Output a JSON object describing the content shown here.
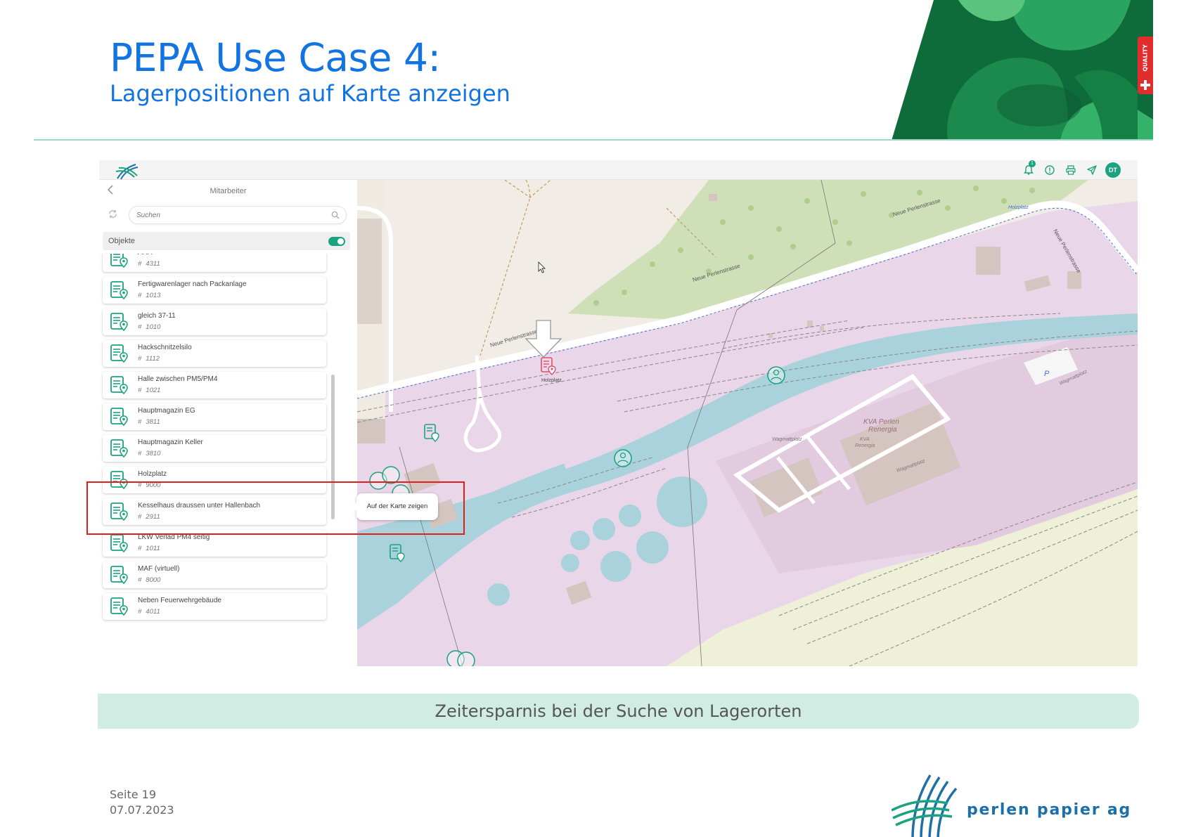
{
  "slide": {
    "title": "PEPA Use Case 4:",
    "subtitle": "Lagerpositionen auf Karte anzeigen",
    "banner": "Zeitersparnis bei der Suche von Lagerorten",
    "page_label": "Seite 19",
    "date": "07.07.2023",
    "company": "perlen papier ag",
    "quality_badge": "QUALITY"
  },
  "app": {
    "topbar": {
      "icons": [
        "bell-icon",
        "alert-icon",
        "printer-icon",
        "send-icon"
      ],
      "notification_count": "1",
      "avatar_initials": "DT"
    },
    "sidebar": {
      "title": "Mitarbeiter",
      "search_placeholder": "Suchen",
      "filter_label": "Objekte",
      "filter_enabled": true,
      "items": [
        {
          "name": "ARA",
          "number": "4311"
        },
        {
          "name": "Fertigwarenlager nach Packanlage",
          "number": "1013"
        },
        {
          "name": "gleich 37-11",
          "number": "1010"
        },
        {
          "name": "Hackschnitzelsilo",
          "number": "1112"
        },
        {
          "name": "Halle zwischen PM5/PM4",
          "number": "1021"
        },
        {
          "name": "Hauptmagazin EG",
          "number": "3811"
        },
        {
          "name": "Hauptmagazin Keller",
          "number": "3810"
        },
        {
          "name": "Holzplatz",
          "number": "9000"
        },
        {
          "name": "Kesselhaus draussen unter Hallenbach",
          "number": "2911"
        },
        {
          "name": "LKW Verlad PM4 seitig",
          "number": "1011"
        },
        {
          "name": "MAF (virtuell)",
          "number": "8000"
        },
        {
          "name": "Neben Feuerwehrgebäude",
          "number": "4011"
        }
      ]
    },
    "tooltip": "Auf der Karte zeigen",
    "map": {
      "selected_marker_label": "Holzplatz",
      "street_labels": [
        "Neue Perlenstrasse",
        "Neue Perlenstrasse",
        "Neue Perlenstrasse",
        "Neue Perlenstrasse"
      ],
      "poi_labels": [
        "KVA Perlen",
        "Renergia",
        "KVA",
        "Renergia",
        "Wagmattplatz",
        "Wagmattplatz",
        "Wagmattplatz",
        "P",
        "Holzplatz"
      ]
    }
  },
  "colors": {
    "title_blue": "#1273e3",
    "accent_green": "#1aa37e",
    "marker_red": "#e0506a",
    "highlight_red": "#e01e1e",
    "banner_bg": "#d1ece2"
  }
}
